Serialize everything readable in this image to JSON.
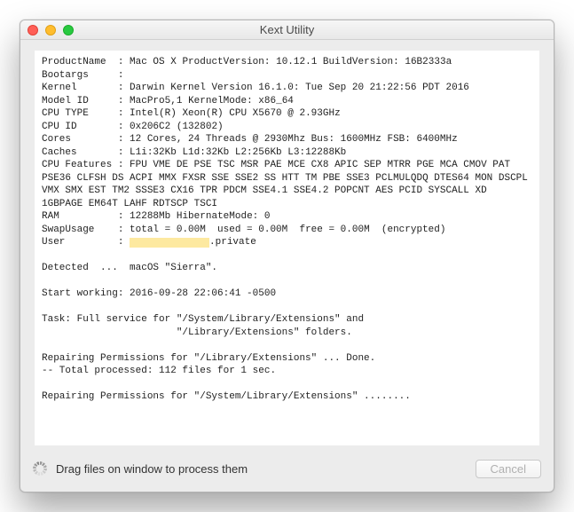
{
  "window": {
    "title": "Kext Utility",
    "footer_text": "Drag files on window to process them",
    "cancel_label": "Cancel"
  },
  "log": {
    "product_name_label": "ProductName",
    "product_name": "Mac OS X",
    "product_version_label": "ProductVersion:",
    "product_version": "10.12.1",
    "build_version_label": "BuildVersion:",
    "build_version": "16B2333a",
    "bootargs_label": "Bootargs",
    "bootargs": "",
    "kernel_label": "Kernel",
    "kernel": "Darwin Kernel Version 16.1.0: Tue Sep 20 21:22:56 PDT 2016",
    "model_id_label": "Model ID",
    "model_id": "MacPro5,1",
    "kernel_mode_label": "KernelMode:",
    "kernel_mode": "x86_64",
    "cpu_type_label": "CPU TYPE",
    "cpu_type": "Intel(R) Xeon(R) CPU X5670 @ 2.93GHz",
    "cpu_id_label": "CPU ID",
    "cpu_id": "0x206C2 (132802)",
    "cores_label": "Cores",
    "cores": "12 Cores, 24 Threads @ 2930Mhz Bus: 1600MHz FSB: 6400MHz",
    "caches_label": "Caches",
    "caches": "L1i:32Kb L1d:32Kb L2:256Kb L3:12288Kb",
    "cpu_features_label": "CPU Features :",
    "cpu_features": "FPU VME DE PSE TSC MSR PAE MCE CX8 APIC SEP MTRR PGE MCA CMOV PAT PSE36 CLFSH DS ACPI MMX FXSR SSE SSE2 SS HTT TM PBE SSE3 PCLMULQDQ DTES64 MON DSCPL VMX SMX EST TM2 SSSE3 CX16 TPR PDCM SSE4.1 SSE4.2 POPCNT AES PCID SYSCALL XD 1GBPAGE EM64T LAHF RDTSCP TSCI",
    "ram_label": "RAM",
    "ram": "12288Mb",
    "hibernate_label": "HibernateMode:",
    "hibernate": "0",
    "swap_label": "SwapUsage",
    "swap": "total = 0.00M  used = 0.00M  free = 0.00M  (encrypted)",
    "user_label": "User",
    "user_suffix": ".private",
    "detected": "Detected  ...  macOS \"Sierra\".",
    "start_working": "Start working: 2016-09-28 22:06:41 -0500",
    "task_line1": "Task: Full service for \"/System/Library/Extensions\" and",
    "task_line2": "                       \"/Library/Extensions\" folders.",
    "repair1": "Repairing Permissions for \"/Library/Extensions\" ... Done.",
    "repair1_stats": "-- Total processed: 112 files for 1 sec.",
    "repair2": "Repairing Permissions for \"/System/Library/Extensions\" ........"
  }
}
